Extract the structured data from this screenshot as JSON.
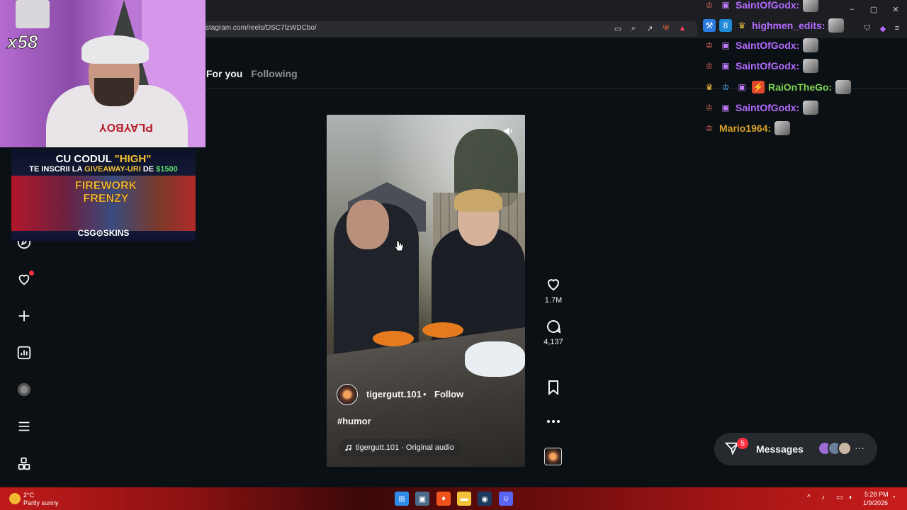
{
  "browser": {
    "url": "stagram.com/reels/DSC7lzWDCbo/"
  },
  "feed": {
    "tabs": [
      {
        "label": "For you",
        "active": true
      },
      {
        "label": "Following",
        "active": false
      }
    ]
  },
  "nav": {
    "items": [
      "explore-icon",
      "heart-icon",
      "create-icon",
      "insights-icon",
      "profile-avatar",
      "menu-icon",
      "more-apps-icon"
    ],
    "notification_dot_color": "#ff3040"
  },
  "reel": {
    "author": "tigergutt.101",
    "separator": "•",
    "follow_label": "Follow",
    "caption": "#humor",
    "audio": "tigergutt.101 · Original audio",
    "likes": "1.7M",
    "comments": "4,137"
  },
  "messages": {
    "label": "Messages",
    "badge": "5"
  },
  "stream_overlay": {
    "combo": "x58",
    "shirt_text": "PLAYBOY",
    "promo": {
      "line1_prefix": "CU CODUL",
      "line1_code": "\"HIGH\"",
      "line2_prefix": "TE INSCRII LA",
      "line2_highlight": "GIVEAWAY-URI",
      "line2_mid": "DE",
      "line2_amount": "$1500",
      "game_title_1": "FIREWORK",
      "game_title_2": "FRENZY",
      "brand": "CSG⊙SKINS"
    }
  },
  "chat": [
    {
      "name": "SaintOfGodx:",
      "color": "#b36bff"
    },
    {
      "name": "highmen_edits:",
      "color": "#b36bff"
    },
    {
      "name": "SaintOfGodx:",
      "color": "#b36bff"
    },
    {
      "name": "SaintOfGodx:",
      "color": "#b36bff"
    },
    {
      "name": "RaiOnTheGo:",
      "color": "#7fd34e"
    },
    {
      "name": "SaintOfGodx:",
      "color": "#b36bff"
    },
    {
      "name": "Mario1964:",
      "color": "#d9a12a"
    }
  ],
  "taskbar": {
    "temperature": "2°C",
    "weather": "Partly sunny",
    "time": "5:28 PM",
    "date": "1/9/2026"
  },
  "colors": {
    "background": "#0b1014",
    "accent_red": "#ff3040"
  }
}
